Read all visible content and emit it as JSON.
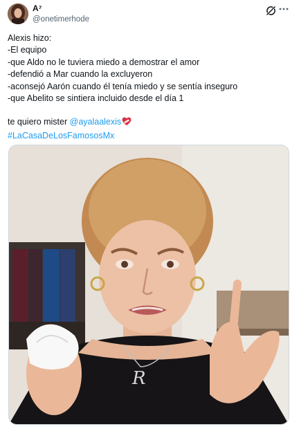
{
  "author": {
    "display_name": "A⁷",
    "handle": "@onetimerhode",
    "avatar_icon": "avatar-photo"
  },
  "header_actions": {
    "grok_icon": "grok-icon",
    "more_icon": "more-dots-icon"
  },
  "tweet": {
    "lines": [
      "Alexis hizo:",
      "-El equipo",
      "-que Aldo no le tuviera miedo a demostrar el amor",
      "-defendió a Mar cuando la excluyeron",
      "-aconsejó Aarón cuando él tenía miedo y se sentía inseguro",
      "-que Abelito se sintiera incluido desde el día 1"
    ],
    "closing_text": "te quiero mister",
    "mention": "@ayalaalexis",
    "heart_emoji": "heart-with-bandage-emoji",
    "hashtag": "#LaCasaDeLosFamososMx"
  },
  "media": {
    "kind": "photo",
    "subject": "crying-woman-photo"
  },
  "colors": {
    "link": "#1d9bf0",
    "text": "#0f1419",
    "secondary": "#536471",
    "border": "#cfd9de"
  }
}
